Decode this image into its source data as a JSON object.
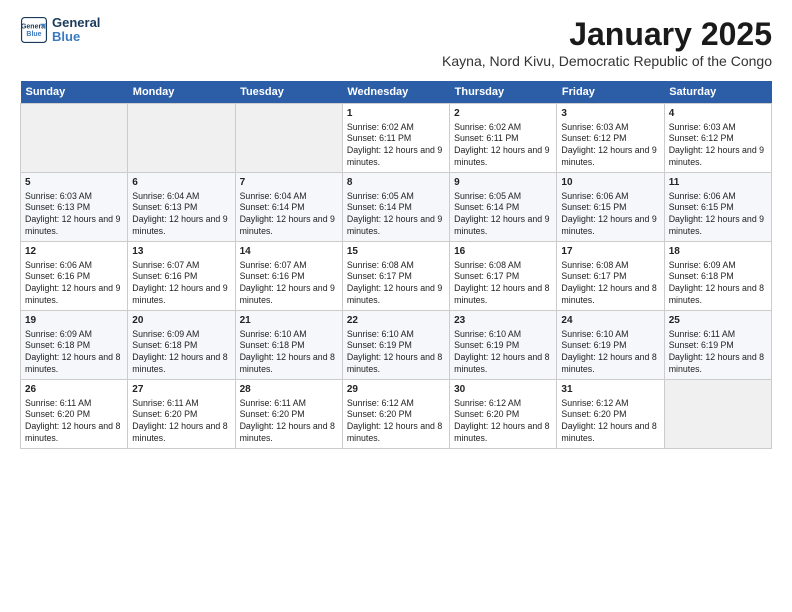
{
  "logo": {
    "line1": "General",
    "line2": "Blue"
  },
  "title": "January 2025",
  "subtitle": "Kayna, Nord Kivu, Democratic Republic of the Congo",
  "days_of_week": [
    "Sunday",
    "Monday",
    "Tuesday",
    "Wednesday",
    "Thursday",
    "Friday",
    "Saturday"
  ],
  "weeks": [
    [
      {
        "day": "",
        "content": ""
      },
      {
        "day": "",
        "content": ""
      },
      {
        "day": "",
        "content": ""
      },
      {
        "day": "1",
        "content": "Sunrise: 6:02 AM\nSunset: 6:11 PM\nDaylight: 12 hours and 9 minutes."
      },
      {
        "day": "2",
        "content": "Sunrise: 6:02 AM\nSunset: 6:11 PM\nDaylight: 12 hours and 9 minutes."
      },
      {
        "day": "3",
        "content": "Sunrise: 6:03 AM\nSunset: 6:12 PM\nDaylight: 12 hours and 9 minutes."
      },
      {
        "day": "4",
        "content": "Sunrise: 6:03 AM\nSunset: 6:12 PM\nDaylight: 12 hours and 9 minutes."
      }
    ],
    [
      {
        "day": "5",
        "content": "Sunrise: 6:03 AM\nSunset: 6:13 PM\nDaylight: 12 hours and 9 minutes."
      },
      {
        "day": "6",
        "content": "Sunrise: 6:04 AM\nSunset: 6:13 PM\nDaylight: 12 hours and 9 minutes."
      },
      {
        "day": "7",
        "content": "Sunrise: 6:04 AM\nSunset: 6:14 PM\nDaylight: 12 hours and 9 minutes."
      },
      {
        "day": "8",
        "content": "Sunrise: 6:05 AM\nSunset: 6:14 PM\nDaylight: 12 hours and 9 minutes."
      },
      {
        "day": "9",
        "content": "Sunrise: 6:05 AM\nSunset: 6:14 PM\nDaylight: 12 hours and 9 minutes."
      },
      {
        "day": "10",
        "content": "Sunrise: 6:06 AM\nSunset: 6:15 PM\nDaylight: 12 hours and 9 minutes."
      },
      {
        "day": "11",
        "content": "Sunrise: 6:06 AM\nSunset: 6:15 PM\nDaylight: 12 hours and 9 minutes."
      }
    ],
    [
      {
        "day": "12",
        "content": "Sunrise: 6:06 AM\nSunset: 6:16 PM\nDaylight: 12 hours and 9 minutes."
      },
      {
        "day": "13",
        "content": "Sunrise: 6:07 AM\nSunset: 6:16 PM\nDaylight: 12 hours and 9 minutes."
      },
      {
        "day": "14",
        "content": "Sunrise: 6:07 AM\nSunset: 6:16 PM\nDaylight: 12 hours and 9 minutes."
      },
      {
        "day": "15",
        "content": "Sunrise: 6:08 AM\nSunset: 6:17 PM\nDaylight: 12 hours and 9 minutes."
      },
      {
        "day": "16",
        "content": "Sunrise: 6:08 AM\nSunset: 6:17 PM\nDaylight: 12 hours and 8 minutes."
      },
      {
        "day": "17",
        "content": "Sunrise: 6:08 AM\nSunset: 6:17 PM\nDaylight: 12 hours and 8 minutes."
      },
      {
        "day": "18",
        "content": "Sunrise: 6:09 AM\nSunset: 6:18 PM\nDaylight: 12 hours and 8 minutes."
      }
    ],
    [
      {
        "day": "19",
        "content": "Sunrise: 6:09 AM\nSunset: 6:18 PM\nDaylight: 12 hours and 8 minutes."
      },
      {
        "day": "20",
        "content": "Sunrise: 6:09 AM\nSunset: 6:18 PM\nDaylight: 12 hours and 8 minutes."
      },
      {
        "day": "21",
        "content": "Sunrise: 6:10 AM\nSunset: 6:18 PM\nDaylight: 12 hours and 8 minutes."
      },
      {
        "day": "22",
        "content": "Sunrise: 6:10 AM\nSunset: 6:19 PM\nDaylight: 12 hours and 8 minutes."
      },
      {
        "day": "23",
        "content": "Sunrise: 6:10 AM\nSunset: 6:19 PM\nDaylight: 12 hours and 8 minutes."
      },
      {
        "day": "24",
        "content": "Sunrise: 6:10 AM\nSunset: 6:19 PM\nDaylight: 12 hours and 8 minutes."
      },
      {
        "day": "25",
        "content": "Sunrise: 6:11 AM\nSunset: 6:19 PM\nDaylight: 12 hours and 8 minutes."
      }
    ],
    [
      {
        "day": "26",
        "content": "Sunrise: 6:11 AM\nSunset: 6:20 PM\nDaylight: 12 hours and 8 minutes."
      },
      {
        "day": "27",
        "content": "Sunrise: 6:11 AM\nSunset: 6:20 PM\nDaylight: 12 hours and 8 minutes."
      },
      {
        "day": "28",
        "content": "Sunrise: 6:11 AM\nSunset: 6:20 PM\nDaylight: 12 hours and 8 minutes."
      },
      {
        "day": "29",
        "content": "Sunrise: 6:12 AM\nSunset: 6:20 PM\nDaylight: 12 hours and 8 minutes."
      },
      {
        "day": "30",
        "content": "Sunrise: 6:12 AM\nSunset: 6:20 PM\nDaylight: 12 hours and 8 minutes."
      },
      {
        "day": "31",
        "content": "Sunrise: 6:12 AM\nSunset: 6:20 PM\nDaylight: 12 hours and 8 minutes."
      },
      {
        "day": "",
        "content": ""
      }
    ]
  ]
}
